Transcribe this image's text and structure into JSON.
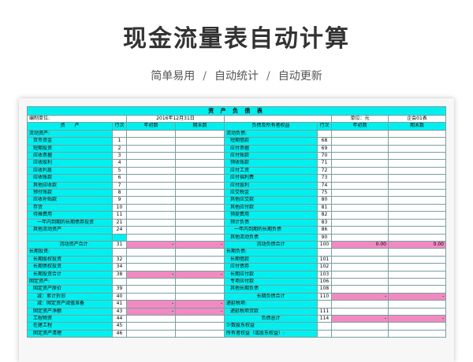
{
  "page": {
    "title": "现金流量表自动计算",
    "subtitle": [
      "简单易用",
      "自动统计",
      "自动更新"
    ],
    "subtitle_sep": "/"
  },
  "sheet": {
    "title": "资 产 负 债 表",
    "meta": {
      "unit_label": "编制单位:",
      "date": "2016年12月31日",
      "currency": "单位：元",
      "form_no": "企会01表"
    },
    "headers": [
      "资　　产",
      "行次",
      "年初数",
      "期末数",
      "负债及所有者权益",
      "行次",
      "年初数",
      "期末数"
    ],
    "rows": [
      {
        "l": "流动资产:",
        "ln": "",
        "r": "流动负债:",
        "rn": ""
      },
      {
        "l": "货币资金",
        "ln": "1",
        "r": "短期借款",
        "rn": "68",
        "li": 1,
        "ri": 1
      },
      {
        "l": "短期投资",
        "ln": "2",
        "r": "应付票据",
        "rn": "69",
        "li": 1,
        "ri": 1
      },
      {
        "l": "应收票据",
        "ln": "3",
        "r": "应付账款",
        "rn": "70",
        "li": 1,
        "ri": 1
      },
      {
        "l": "应收股利",
        "ln": "4",
        "r": "预收账款",
        "rn": "71",
        "li": 1,
        "ri": 1
      },
      {
        "l": "应收利息",
        "ln": "5",
        "r": "应付工资",
        "rn": "72",
        "li": 1,
        "ri": 1
      },
      {
        "l": "应收账款",
        "ln": "6",
        "r": "应付福利费",
        "rn": "73",
        "li": 1,
        "ri": 1
      },
      {
        "l": "其他应收款",
        "ln": "7",
        "r": "应付股利",
        "rn": "74",
        "li": 1,
        "ri": 1
      },
      {
        "l": "预付账款",
        "ln": "8",
        "r": "应交税金",
        "rn": "75",
        "li": 1,
        "ri": 1
      },
      {
        "l": "应收补贴款",
        "ln": "9",
        "r": "其他应交款",
        "rn": "80",
        "li": 1,
        "ri": 1
      },
      {
        "l": "存货",
        "ln": "10",
        "r": "其他应付款",
        "rn": "81",
        "li": 1,
        "ri": 1
      },
      {
        "l": "待摊费用",
        "ln": "11",
        "r": "预提费用",
        "rn": "82",
        "li": 1,
        "ri": 1
      },
      {
        "l": "一年内到期的长期债券投资",
        "ln": "21",
        "r": "预计负债",
        "rn": "83",
        "li": 2,
        "ri": 1
      },
      {
        "l": "其他流动资产",
        "ln": "24",
        "r": "一年内到期的长期负债",
        "rn": "86",
        "li": 1,
        "ri": 2
      },
      {
        "l": "",
        "ln": "",
        "r": "其他流动负债",
        "rn": "90",
        "ri": 1,
        "blankLeft": true
      },
      {
        "l": "流动资产合计",
        "ln": "31",
        "lb": "-",
        "le": "-",
        "r": "流动负债合计",
        "rn": "100",
        "rb": "0.00",
        "re": "0.00",
        "li": 2,
        "ri": 3,
        "pink": true,
        "tot": true
      },
      {
        "l": "长期投资:",
        "ln": "",
        "r": "长期负债:",
        "rn": ""
      },
      {
        "l": "长期股权投资",
        "ln": "32",
        "r": "长期借款",
        "rn": "101",
        "li": 1,
        "ri": 1
      },
      {
        "l": "长期债权投资",
        "ln": "34",
        "r": "应付债券",
        "rn": "102",
        "li": 1,
        "ri": 1
      },
      {
        "l": "长期投资合计",
        "ln": "38",
        "lb": "-",
        "le": "-",
        "r": "长期应付款",
        "rn": "103",
        "li": 1,
        "ri": 1,
        "pinkL": true
      },
      {
        "l": "固定资产:",
        "ln": "",
        "r": "专项应付款",
        "rn": "106",
        "ri": 1
      },
      {
        "l": "固定资产原价",
        "ln": "39",
        "r": "其他长期负债",
        "rn": "108",
        "li": 1,
        "ri": 1
      },
      {
        "l": "减：累计折旧",
        "ln": "40",
        "r": "长期负债合计",
        "rn": "110",
        "rb": "-",
        "re": "-",
        "li": 2,
        "ri": 3,
        "pinkR": true
      },
      {
        "l": "减：固定资产减值准备",
        "ln": "41",
        "lb": "-",
        "le": "-",
        "r": "递延税项:",
        "rn": "",
        "li": 2,
        "pinkL": true
      },
      {
        "l": "固定资产净额",
        "ln": "43",
        "lb": "-",
        "le": "-",
        "r": "递延税项贷款",
        "rn": "111",
        "li": 1,
        "ri": 1,
        "pinkL": true
      },
      {
        "l": "工程物资",
        "ln": "44",
        "r": "负债总计",
        "rn": "114",
        "rb": "-",
        "re": "-",
        "li": 1,
        "ri": 3,
        "pinkR": true
      },
      {
        "l": "在建工程",
        "ln": "45",
        "r": "少数股东权益",
        "rn": "",
        "li": 1
      },
      {
        "l": "固定资产清理",
        "ln": "46",
        "r": "所有者权益（或股东权益）:",
        "rn": "",
        "li": 1
      }
    ]
  }
}
